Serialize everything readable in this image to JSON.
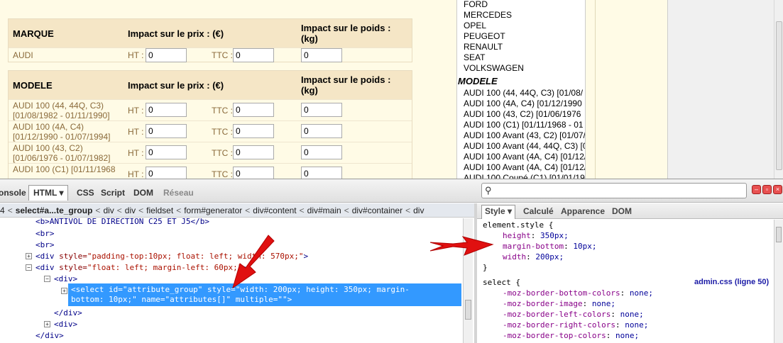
{
  "marque_table": {
    "col1": "MARQUE",
    "col2": "Impact sur le prix : (€)",
    "col3_line1": "Impact sur le poids :",
    "col3_line2": "(kg)",
    "rows": [
      {
        "name_line1": "AUDI",
        "name_line2": "",
        "ht_label": "HT :",
        "ht": "0",
        "ttc_label": "TTC :",
        "ttc": "0",
        "poids": "0"
      }
    ]
  },
  "modele_table": {
    "col1": "MODELE",
    "col2": "Impact sur le prix : (€)",
    "col3_line1": "Impact sur le poids :",
    "col3_line2": "(kg)",
    "rows": [
      {
        "name_line1": "AUDI 100 (44, 44Q, C3)",
        "name_line2": "[01/08/1982 - 01/11/1990]",
        "ht_label": "HT :",
        "ht": "0",
        "ttc_label": "TTC :",
        "ttc": "0",
        "poids": "0"
      },
      {
        "name_line1": "AUDI 100 (4A, C4)",
        "name_line2": "[01/12/1990 - 01/07/1994]",
        "ht_label": "HT :",
        "ht": "0",
        "ttc_label": "TTC :",
        "ttc": "0",
        "poids": "0"
      },
      {
        "name_line1": "AUDI 100 (43, C2)",
        "name_line2": "[01/06/1976 - 01/07/1982]",
        "ht_label": "HT :",
        "ht": "0",
        "ttc_label": "TTC :",
        "ttc": "0",
        "poids": "0"
      },
      {
        "name_line1": "AUDI 100 (C1) [01/11/1968",
        "name_line2": "",
        "ht_label": "HT :",
        "ht": "0",
        "ttc_label": "TTC :",
        "ttc": "0",
        "poids": "0"
      }
    ]
  },
  "select_list": {
    "brands": [
      "FORD",
      "MERCEDES",
      "OPEL",
      "PEUGEOT",
      "RENAULT",
      "SEAT",
      "VOLKSWAGEN"
    ],
    "group_label": "MODELE",
    "models": [
      "AUDI 100 (44, 44Q, C3) [01/08/",
      "AUDI 100 (4A, C4) [01/12/1990",
      "AUDI 100 (43, C2) [01/06/1976",
      "AUDI 100 (C1) [01/11/1968 - 01",
      "AUDI 100 Avant (43, C2) [01/07/",
      "AUDI 100 Avant (44, 44Q, C3) [0",
      "AUDI 100 Avant (4A, C4) [01/12/",
      "AUDI 100 Avant (4A, C4) [01/12/",
      "AUDI 100 Coupé (C1) [01/01/19"
    ]
  },
  "firebug": {
    "tabs": [
      "onsole",
      "HTML",
      "CSS",
      "Script",
      "DOM",
      "Réseau"
    ],
    "tab_dropdown": "▾",
    "search_placeholder": "",
    "breadcrumb": {
      "prefix": "4",
      "current": "select#a...te_group",
      "items": [
        "div",
        "div",
        "fieldset",
        "form#generator",
        "div#content",
        "div#main",
        "div#container",
        "div"
      ]
    },
    "side_tabs": [
      "Style",
      "Calculé",
      "Apparence",
      "DOM"
    ],
    "html_lines": {
      "l1": "<b>ANTIVOL DE DIRECTION C25 ET J5</b>",
      "l2": "<br>",
      "l3": "<br>",
      "l4_tag": "<div",
      "l4_attr": " style=",
      "l4_val": "\"padding-top:10px; float: left; width: 570px;\"",
      "l4_end": ">",
      "l5_tag": "<div",
      "l5_attr": " style=",
      "l5_val": "\"float: left; margin-left: 60px;\"",
      "l5_end": ">",
      "l6": "<div>",
      "sel_line1": "<select id=\"attribute_group\" style=\"width: 200px; height: 350px; margin-",
      "sel_line2": "bottom: 10px;\" name=\"attributes[]\" multiple=\"\">",
      "l8": "</div>",
      "l9": "<div>",
      "l10": "</div>"
    },
    "css": {
      "rule1_selector": "element.style {",
      "rule1_props": [
        {
          "name": "height",
          "value": "350px;"
        },
        {
          "name": "margin-bottom",
          "value": "10px;"
        },
        {
          "name": "width",
          "value": "200px;"
        }
      ],
      "rule1_close": "}",
      "rule2_selector": "select {",
      "rule2_source": "admin.css (ligne 50)",
      "rule2_props": [
        {
          "name": "-moz-border-bottom-colors",
          "value": "none;"
        },
        {
          "name": "-moz-border-image",
          "value": "none;"
        },
        {
          "name": "-moz-border-left-colors",
          "value": "none;"
        },
        {
          "name": "-moz-border-right-colors",
          "value": "none;"
        },
        {
          "name": "-moz-border-top-colors",
          "value": "none;"
        }
      ]
    }
  },
  "colors": {
    "annotation_arrow": "#e01010",
    "selection": "#3399ff"
  }
}
